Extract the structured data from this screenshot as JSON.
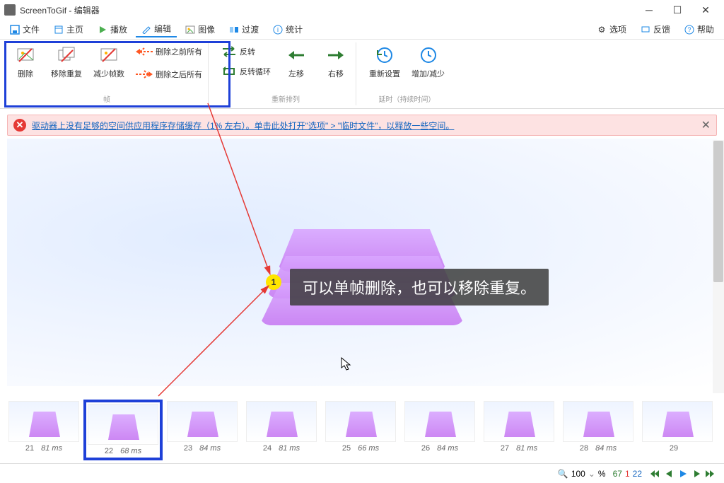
{
  "title": "ScreenToGif - 编辑器",
  "menu": {
    "file": "文件",
    "home": "主页",
    "play": "播放",
    "edit": "编辑",
    "image": "图像",
    "transition": "过渡",
    "stats": "统计",
    "options": "选项",
    "feedback": "反馈",
    "help": "帮助"
  },
  "ribbon": {
    "frame_group": "帧",
    "delete": "删除",
    "remove_dup": "移除重复",
    "reduce_frames": "减少帧数",
    "delete_before": "删除之前所有",
    "delete_after": "删除之后所有",
    "rearrange_group": "重新排列",
    "reverse": "反转",
    "reverse_loop": "反转循环",
    "move_left": "左移",
    "move_right": "右移",
    "delay_group": "延时（持续时间）",
    "reset": "重新设置",
    "inc_dec": "增加/减少"
  },
  "warning": {
    "text": "驱动器上没有足够的空间供应用程序存储缓存（1% 左右）。单击此处打开\"选项\" > \"临时文件\"，以释放一些空间。"
  },
  "overlay": {
    "text": "可以单帧删除，也可以移除重复。",
    "marker": "1"
  },
  "thumbs": [
    {
      "n": "21",
      "ms": "81 ms"
    },
    {
      "n": "22",
      "ms": "68 ms"
    },
    {
      "n": "23",
      "ms": "84 ms"
    },
    {
      "n": "24",
      "ms": "81 ms"
    },
    {
      "n": "25",
      "ms": "66 ms"
    },
    {
      "n": "26",
      "ms": "84 ms"
    },
    {
      "n": "27",
      "ms": "81 ms"
    },
    {
      "n": "28",
      "ms": "84 ms"
    },
    {
      "n": "29",
      "ms": ""
    }
  ],
  "status": {
    "zoom": "100",
    "pct": "%",
    "total": "67",
    "sel": "1",
    "cur": "22"
  }
}
